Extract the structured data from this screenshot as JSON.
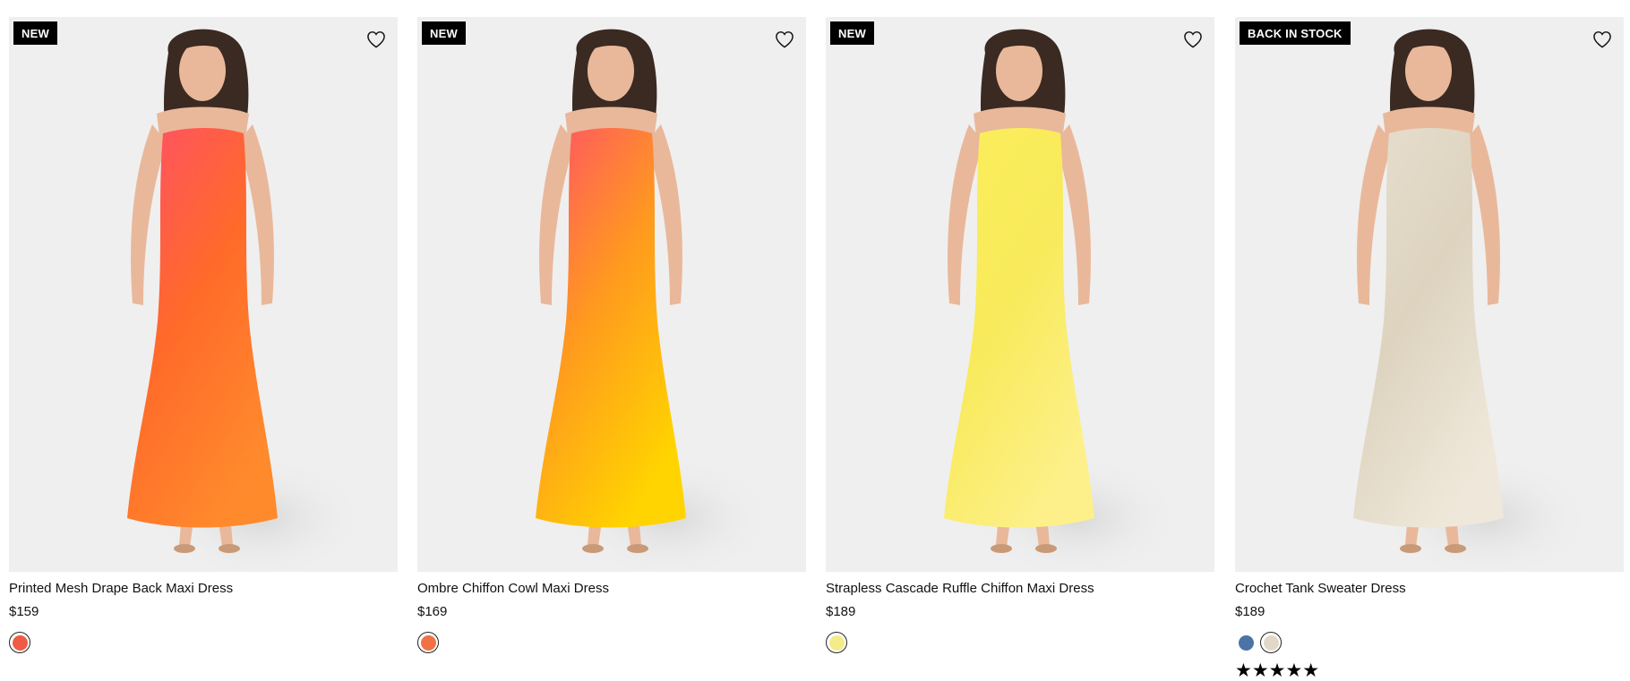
{
  "products": [
    {
      "badge": "NEW",
      "name": "Printed Mesh Drape Back Maxi Dress",
      "price": "$159",
      "wishlist_icon": "heart-outline-icon",
      "swatches": [
        {
          "color": "#ef5b45",
          "selected": true
        }
      ],
      "dress_colors": [
        "#ff4f6a",
        "#ff6a2a",
        "#ff8a2c"
      ],
      "rating": null
    },
    {
      "badge": "NEW",
      "name": "Ombre Chiffon Cowl Maxi Dress",
      "price": "$169",
      "wishlist_icon": "heart-outline-icon",
      "swatches": [
        {
          "color": "#f07244",
          "selected": true
        }
      ],
      "dress_colors": [
        "#ff4f6a",
        "#ff9a1e",
        "#ffd400"
      ],
      "rating": null
    },
    {
      "badge": "NEW",
      "name": "Strapless Cascade Ruffle Chiffon Maxi Dress",
      "price": "$189",
      "wishlist_icon": "heart-outline-icon",
      "swatches": [
        {
          "color": "#f3ec88",
          "selected": true
        }
      ],
      "dress_colors": [
        "#fbee5c",
        "#f8ea5a",
        "#fdf08a"
      ],
      "rating": null
    },
    {
      "badge": "BACK IN STOCK",
      "name": "Crochet Tank Sweater Dress",
      "price": "$189",
      "wishlist_icon": "heart-outline-icon",
      "swatches": [
        {
          "color": "#4d73a6",
          "selected": false
        },
        {
          "color": "#e1d8c7",
          "selected": true
        }
      ],
      "dress_colors": [
        "#e7dfcf",
        "#ddd3bf",
        "#efe8da"
      ],
      "rating": "★★★★★"
    }
  ],
  "colors": {
    "image_bg": "#efefef",
    "badge_bg": "#000000",
    "badge_text": "#ffffff",
    "text": "#111111"
  }
}
